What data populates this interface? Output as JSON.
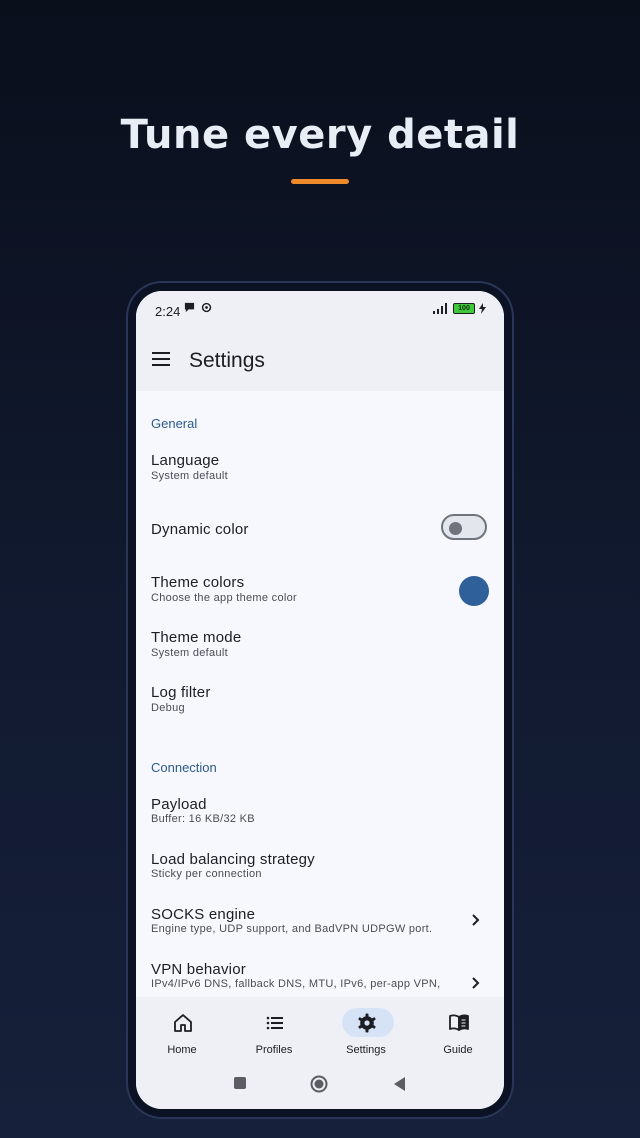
{
  "hero": {
    "headline": "Tune every detail"
  },
  "status_bar": {
    "time": "2:24",
    "battery": "100"
  },
  "app_bar": {
    "title": "Settings"
  },
  "sections": {
    "general": {
      "header": "General",
      "language": {
        "title": "Language",
        "summary": "System default"
      },
      "dynamic_color": {
        "title": "Dynamic color",
        "enabled": false
      },
      "theme_colors": {
        "title": "Theme colors",
        "summary": "Choose the app theme color",
        "swatch": "#30609a"
      },
      "theme_mode": {
        "title": "Theme mode",
        "summary": "System default"
      },
      "log_filter": {
        "title": "Log filter",
        "summary": "Debug"
      }
    },
    "connection": {
      "header": "Connection",
      "payload": {
        "title": "Payload",
        "summary": "Buffer: 16 KB/32 KB"
      },
      "load_balancing": {
        "title": "Load balancing strategy",
        "summary": "Sticky per connection"
      },
      "socks_engine": {
        "title": "SOCKS engine",
        "summary": "Engine type, UDP support, and BadVPN UDPGW port."
      },
      "vpn_behavior": {
        "title": "VPN behavior",
        "summary": "IPv4/IPv6 DNS, fallback DNS, MTU, IPv6, per-app VPN,"
      }
    }
  },
  "bottom_nav": {
    "items": [
      {
        "label": "Home",
        "icon": "home-icon"
      },
      {
        "label": "Profiles",
        "icon": "list-icon"
      },
      {
        "label": "Settings",
        "icon": "gear-icon",
        "selected": true
      },
      {
        "label": "Guide",
        "icon": "book-icon"
      }
    ]
  },
  "colors": {
    "accent": "#f0892a",
    "primary": "#2d5a8b",
    "nav_selected": "#d6e3f7"
  }
}
